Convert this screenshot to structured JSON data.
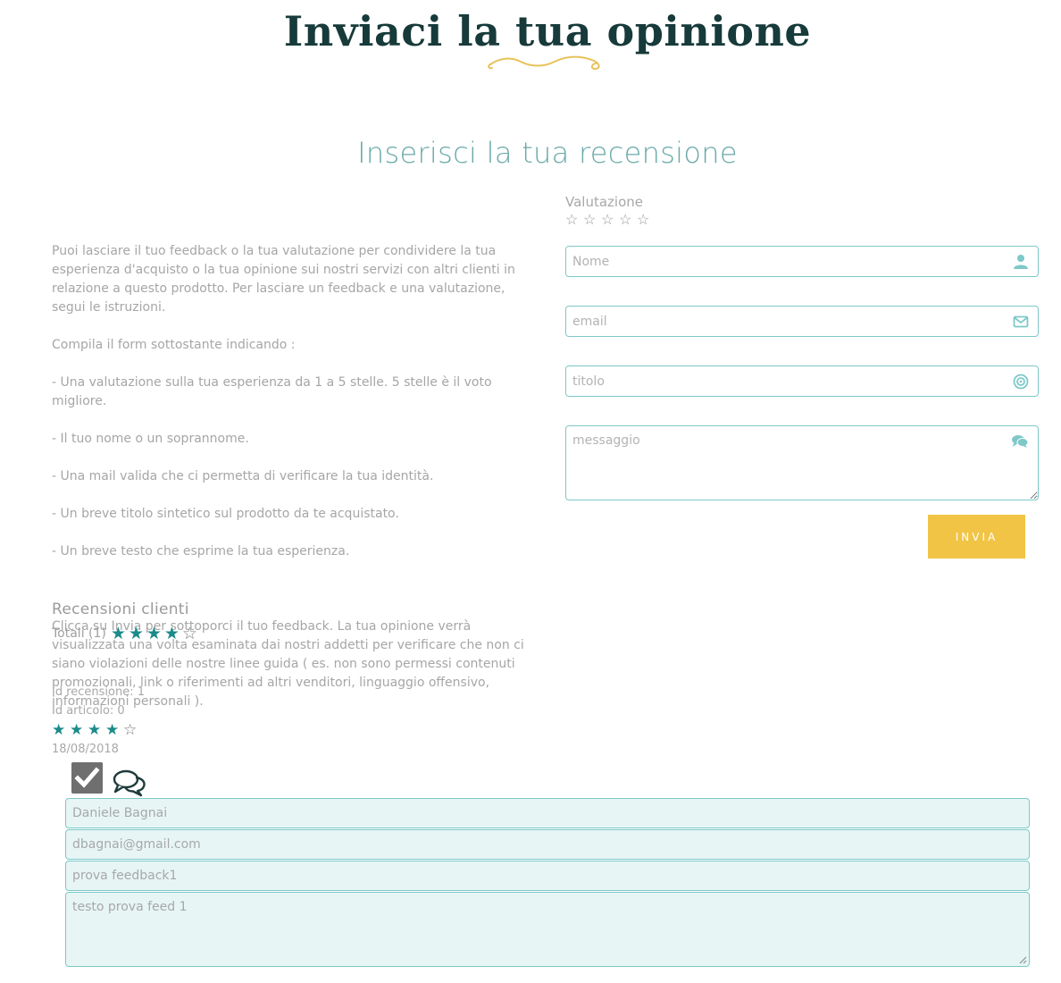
{
  "header": {
    "title": "Inviaci la tua opinione",
    "subtitle": "Inserisci la tua recensione"
  },
  "instructions": {
    "paragraph1": "Puoi lasciare il tuo feedback o la tua valutazione per condividere la tua esperienza d'acquisto o la tua opinione sui nostri servizi con altri clienti in relazione a questo prodotto. Per lasciare un feedback e una valutazione, segui le istruzioni.",
    "intro": "Compila il form sottostante indicando :",
    "items": [
      "- Una valutazione sulla tua esperienza da 1 a 5 stelle. 5 stelle è il voto migliore.",
      "- Il tuo nome o un soprannome.",
      "- Una mail valida che ci permetta di verificare la tua identità.",
      "- Un breve titolo sintetico sul prodotto da te acquistato.",
      "- Un breve testo che esprime la tua esperienza."
    ],
    "paragraph2": "Clicca su Invia per sottoporci il tuo feedback. La tua opinione verrà visualizzata una volta esaminata dai nostri addetti per verificare che non ci siano violazioni delle nostre linee guida ( es. non sono permessi contenuti promozionali, link o riferimenti ad altri venditori, linguaggio offensivo, informazioni personali )."
  },
  "form": {
    "rating_label": "Valutazione",
    "rating_value": 0,
    "rating_max": 5,
    "empty_star": "☆",
    "name_placeholder": "Nome",
    "email_placeholder": "email",
    "title_placeholder": "titolo",
    "message_placeholder": "messaggio",
    "submit_label": "INVIA",
    "icons": [
      "user-icon",
      "envelope-icon",
      "target-icon",
      "comments-icon"
    ]
  },
  "reviews": {
    "title": "Recensioni clienti",
    "totals_label": "Totali (1)",
    "average_rating": 4,
    "max_rating": 5,
    "full_star": "★",
    "empty_star": "☆",
    "items": [
      {
        "id_label": "Id recensione: 1",
        "article_label": "Id articolo: 0",
        "rating": 4,
        "date": "18/08/2018",
        "name": "Daniele Bagnai",
        "email": "dbagnai@gmail.com",
        "title": "prova feedback1",
        "text": "testo prova feed 1"
      }
    ]
  },
  "colors": {
    "accent": "#1b8a8a",
    "field_border": "#7ec8c8",
    "button": "#f1c445",
    "title": "#173a3a",
    "flourish": "#e8c25a"
  }
}
